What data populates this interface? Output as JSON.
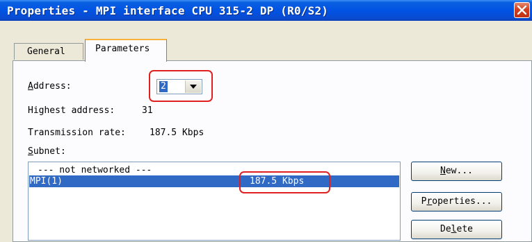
{
  "window": {
    "title": "Properties - MPI interface  CPU 315-2 DP (R0/S2)",
    "close_label": "close"
  },
  "tabs": [
    {
      "label": "General",
      "active": false
    },
    {
      "label": "Parameters",
      "active": true
    }
  ],
  "parameters": {
    "address_label_first": "A",
    "address_label_rest": "ddress:",
    "address_value": "2",
    "highest_address_label": "Highest address:",
    "highest_address_value": "31",
    "transmission_rate_label": "Transmission rate:",
    "transmission_rate_value": "187.5 Kbps",
    "subnet_label_first": "S",
    "subnet_label_rest": "ubnet:"
  },
  "subnet_list": [
    {
      "name": "--- not networked ---",
      "rate": ""
    },
    {
      "name": "MPI(1)",
      "rate": "187.5 Kbps",
      "selected": true
    }
  ],
  "buttons": {
    "new_first": "N",
    "new_rest": "ew...",
    "properties_pre": "P",
    "properties_u": "r",
    "properties_rest": "operties...",
    "delete_pre": "De",
    "delete_u": "l",
    "delete_rest": "ete"
  },
  "colors": {
    "titlebar": "#0054e3",
    "selection": "#316ac5",
    "highlight_outline": "#e02020"
  }
}
